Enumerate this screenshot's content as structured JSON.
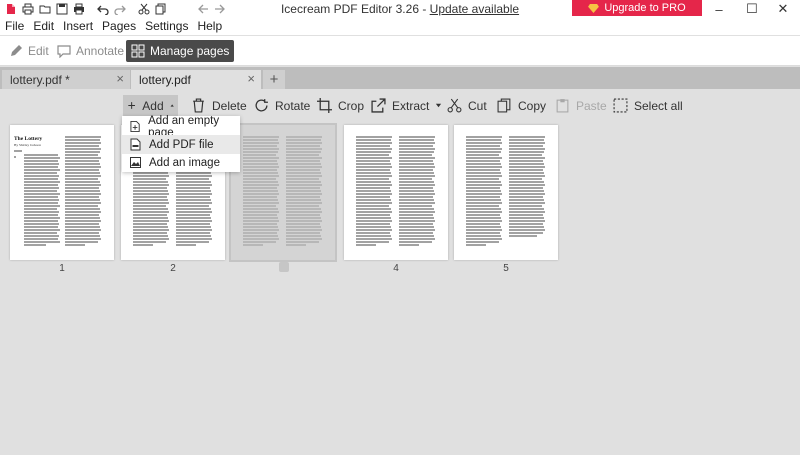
{
  "app": {
    "title": "Icecream PDF Editor 3.26 - ",
    "update_link": "Update available",
    "upgrade_label": "Upgrade to PRO",
    "quick_access_icons": [
      "new-file-icon",
      "open-folder-icon",
      "save-icon",
      "print-icon",
      "undo-icon",
      "redo-icon",
      "cut-icon",
      "copy-icon",
      "back-arrow-icon",
      "forward-arrow-icon"
    ],
    "window_controls": {
      "minimize": "–",
      "maximize": "☐",
      "close": "✕"
    }
  },
  "menu": [
    "File",
    "Edit",
    "Insert",
    "Pages",
    "Settings",
    "Help"
  ],
  "modes": [
    {
      "label": "Edit",
      "active": false
    },
    {
      "label": "Annotate",
      "active": false
    },
    {
      "label": "Manage pages",
      "active": true
    }
  ],
  "tabs": [
    {
      "label": "lottery.pdf *",
      "active": false
    },
    {
      "label": "lottery.pdf",
      "active": true
    }
  ],
  "tab_add_label": "+",
  "tab_close_label": "×",
  "toolbar": {
    "add": "Add",
    "delete": "Delete",
    "rotate": "Rotate",
    "crop": "Crop",
    "extract": "Extract",
    "cut": "Cut",
    "copy": "Copy",
    "paste": "Paste",
    "select_all": "Select all"
  },
  "add_menu": [
    "Add an empty page",
    "Add PDF file",
    "Add an image"
  ],
  "pages": [
    {
      "number": "1",
      "selected": false
    },
    {
      "number": "2",
      "selected": false
    },
    {
      "number": "",
      "selected": true
    },
    {
      "number": "4",
      "selected": false
    },
    {
      "number": "5",
      "selected": false
    }
  ],
  "page1": {
    "title": "The Lottery",
    "author": "By Shirley Jackson"
  },
  "colors": {
    "accent": "#e5264a",
    "active_mode": "#4a4a4a",
    "background": "#e0e0e0"
  }
}
